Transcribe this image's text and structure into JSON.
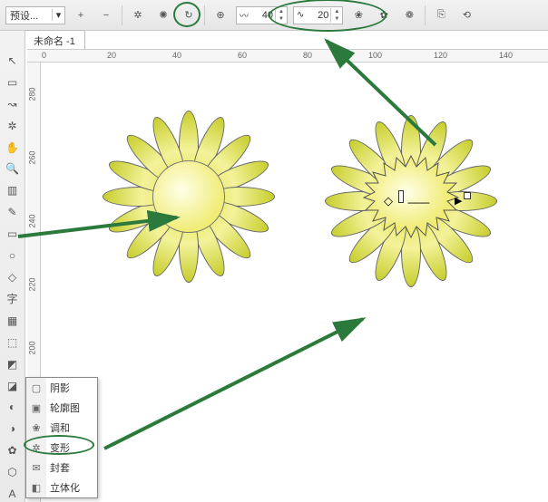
{
  "toolbar": {
    "preset_label": "预设...",
    "plus": "+",
    "minus": "−",
    "value1": "40",
    "value2": "20"
  },
  "tab": {
    "title": "未命名 -1"
  },
  "ruler_h": [
    "0",
    "20",
    "40",
    "60",
    "80",
    "100",
    "120",
    "140"
  ],
  "ruler_v": [
    "280",
    "260",
    "240",
    "220",
    "200"
  ],
  "menu": {
    "items": [
      {
        "icon": "▢",
        "label": "阴影"
      },
      {
        "icon": "▣",
        "label": "轮廓图"
      },
      {
        "icon": "❀",
        "label": "调和"
      },
      {
        "icon": "✲",
        "label": "变形"
      },
      {
        "icon": "✉",
        "label": "封套"
      },
      {
        "icon": "◧",
        "label": "立体化"
      }
    ]
  },
  "left_tools": [
    "↖",
    "▭",
    "↝",
    "✲",
    "✋",
    "🔍",
    "▥",
    "✎",
    "▭",
    "○",
    "◇",
    "字",
    "▦",
    "⬚",
    "◩",
    "◪",
    "◐",
    "◑",
    "✿",
    "⬡",
    "A"
  ],
  "chart_data": {
    "type": "diagram",
    "note": "CorelDRAW screenshot annotated with green ellipses and arrows highlighting the Distort (变形) tool and its zipper parameters 40 / 20 applied to a flower shape"
  }
}
